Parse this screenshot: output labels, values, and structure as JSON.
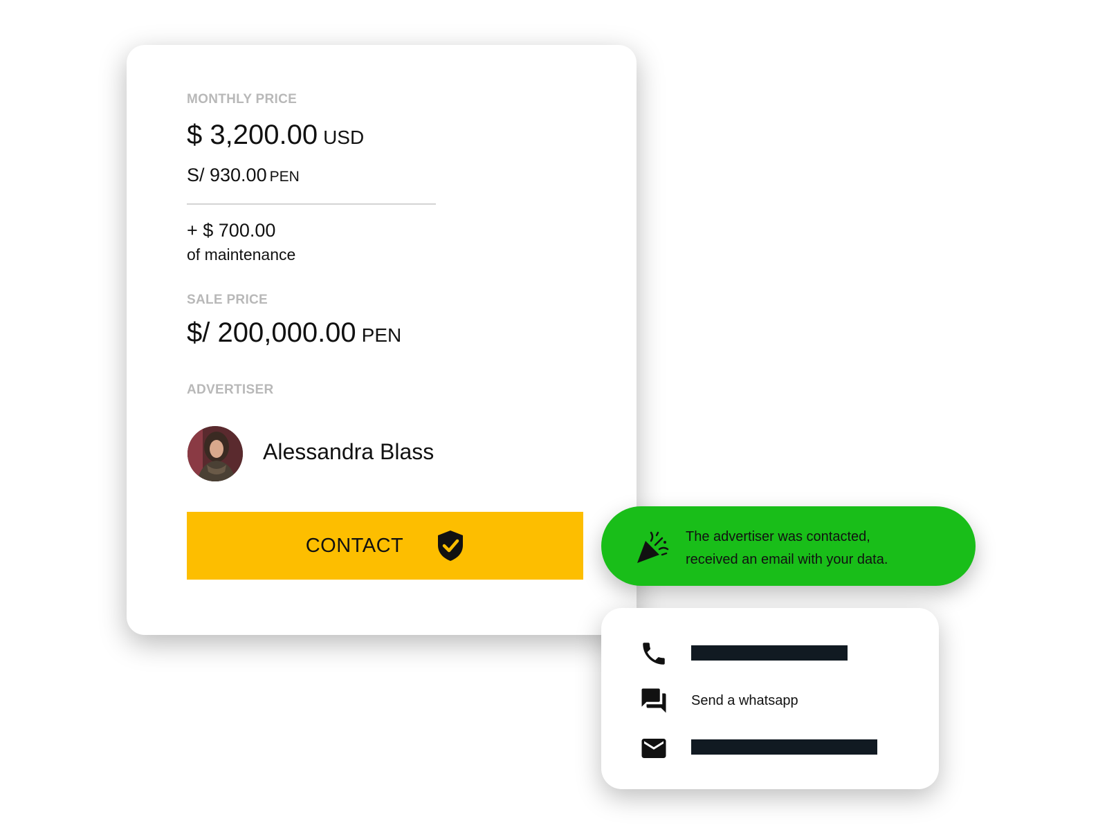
{
  "price_card": {
    "monthly_label": "MONTHLY PRICE",
    "monthly_amount": "$ 3,200.00",
    "monthly_currency": "USD",
    "monthly_alt_amount": "S/ 930.00",
    "monthly_alt_currency": "PEN",
    "maintenance_amount": "+ $ 700.00",
    "maintenance_label": "of maintenance",
    "sale_label": "SALE PRICE",
    "sale_amount": "$/ 200,000.00",
    "sale_currency": "PEN",
    "advertiser_label": "ADVERTISER",
    "advertiser_name": "Alessandra Blass",
    "contact_button_label": "CONTACT"
  },
  "toast": {
    "line1": "The advertiser was contacted,",
    "line2": "received an email with your data.",
    "color": "#19be19"
  },
  "contact_options": {
    "whatsapp_label": "Send a whatsapp"
  },
  "colors": {
    "accent": "#fdbe00",
    "success": "#19be19",
    "muted_label": "#b8b8b8"
  },
  "icons": [
    "shield-check-icon",
    "party-popper-icon",
    "phone-icon",
    "chat-icon",
    "mail-icon"
  ]
}
